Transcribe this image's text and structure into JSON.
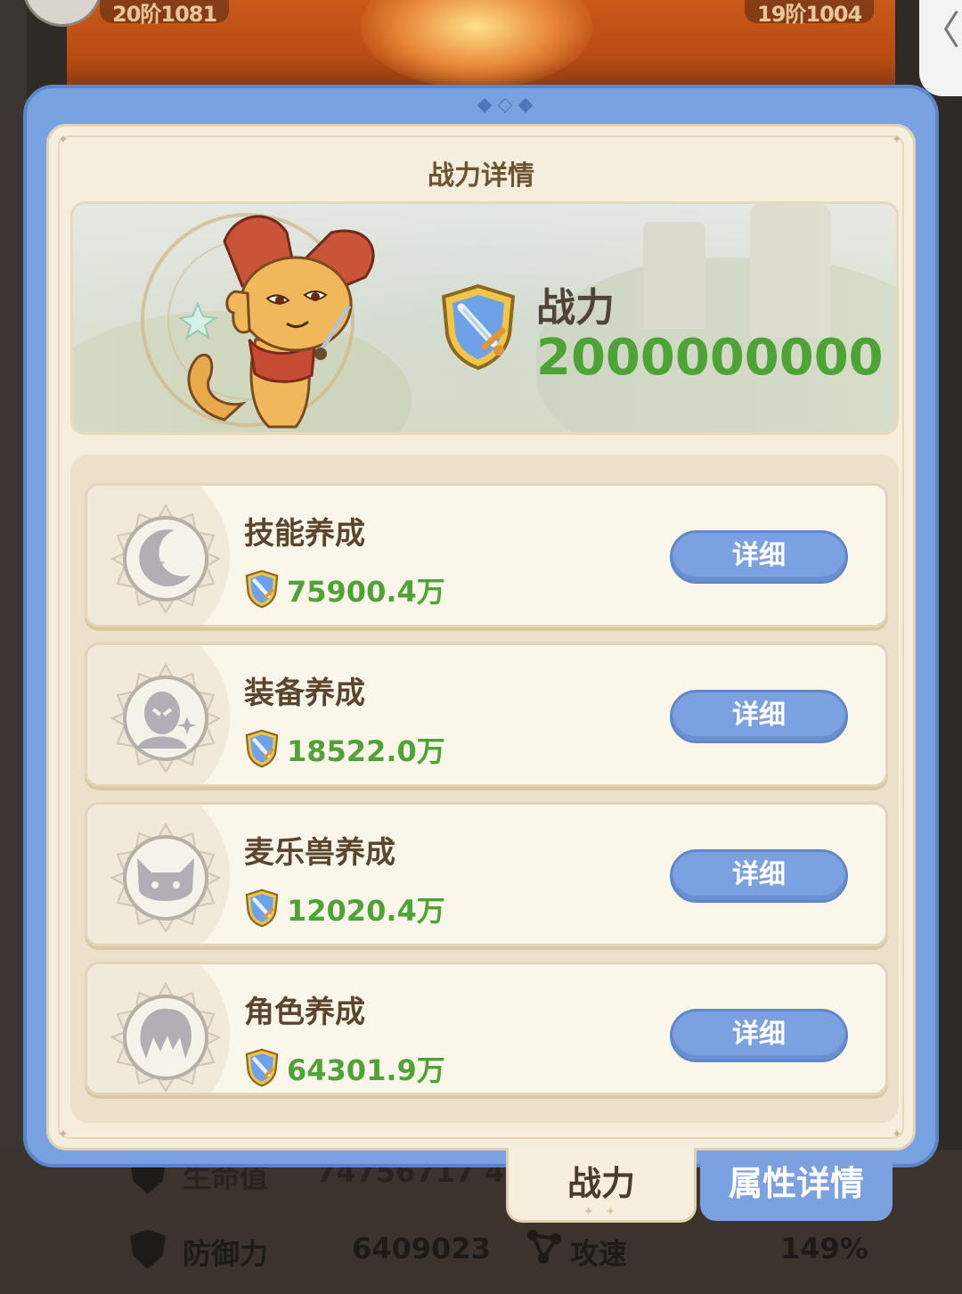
{
  "background": {
    "left_pill": "20阶1081",
    "right_pill": "19阶1004",
    "side_tab_glyph": "〈",
    "stats": {
      "hp_label": "生命值",
      "hp_value": "74756717 44",
      "def_label": "防御力",
      "def_value": "6409023",
      "speed_label": "攻速",
      "speed_value": "149%"
    }
  },
  "panel": {
    "title": "战力详情",
    "power_label": "战力",
    "power_value": "2000000000",
    "rows": [
      {
        "label": "技能养成",
        "value": "75900.4万",
        "button": "详细",
        "icon": "crescent-star-icon"
      },
      {
        "label": "装备养成",
        "value": "18522.0万",
        "button": "详细",
        "icon": "alien-head-icon"
      },
      {
        "label": "麦乐兽养成",
        "value": "12020.4万",
        "button": "详细",
        "icon": "cat-face-icon"
      },
      {
        "label": "角色养成",
        "value": "64301.9万",
        "button": "详细",
        "icon": "hair-head-icon"
      }
    ]
  },
  "tabs": {
    "power": "战力",
    "attributes": "属性详情"
  },
  "colors": {
    "panel_blue": "#79a2e2",
    "button_blue": "#7ba1e0",
    "value_green": "#4ea336",
    "parchment": "#f5eedd"
  }
}
